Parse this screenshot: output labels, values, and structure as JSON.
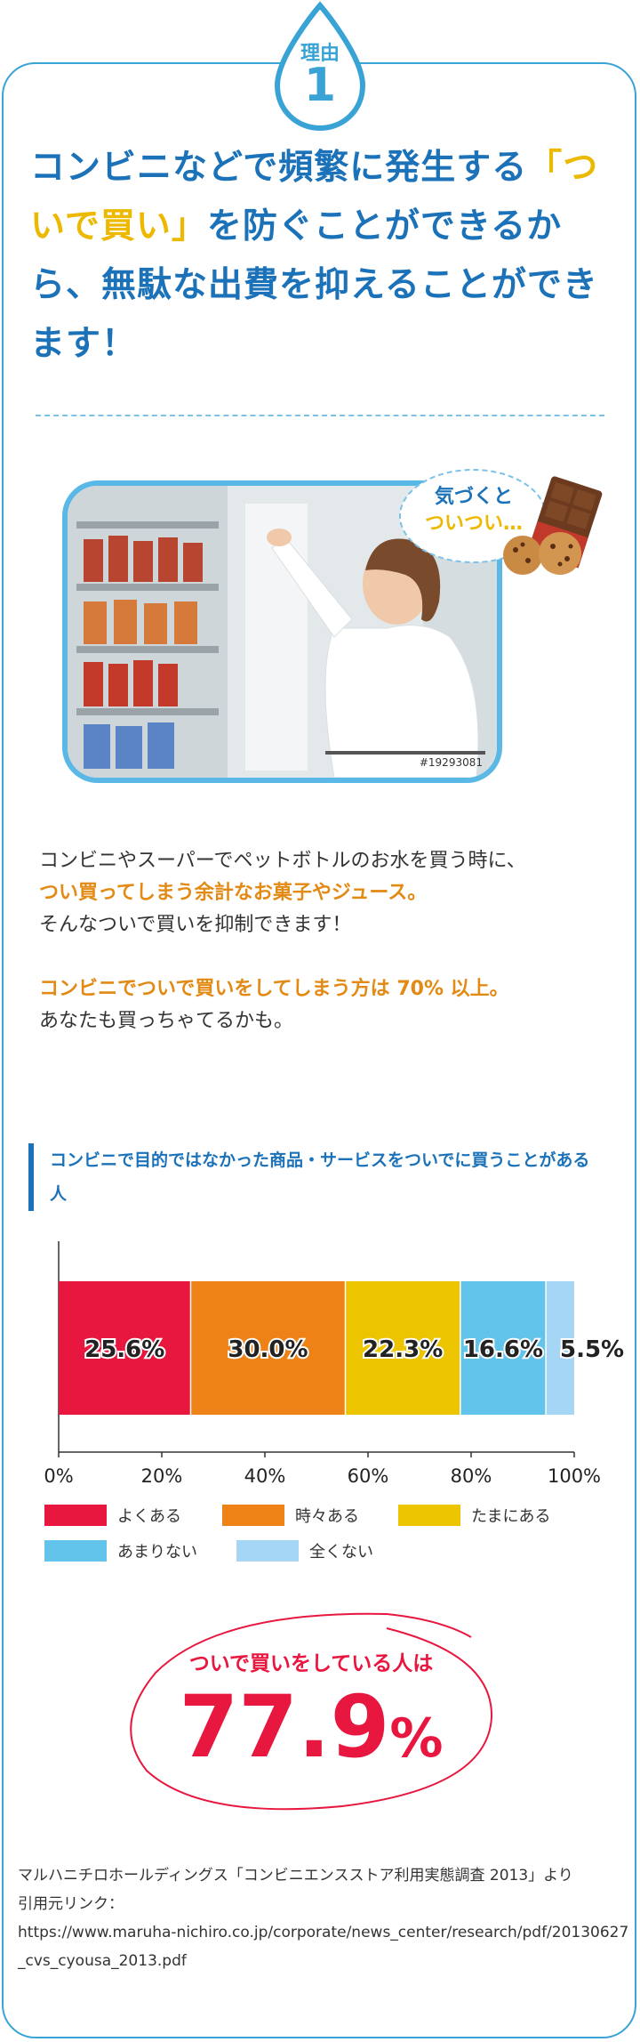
{
  "badge": {
    "label": "理由",
    "number": "1"
  },
  "headline": {
    "part1": "コンビニなどで頻繁に発生する",
    "highlight": "「ついで買い」",
    "part2": "を防ぐことができるから、無駄な出費を抑えることができます！"
  },
  "photo": {
    "stock_id": "#19293081"
  },
  "bubble": {
    "line1": "気づくと",
    "line2": "ついつい…"
  },
  "body": {
    "p1_line1": "コンビニやスーパーでペットボトルのお水を買う時に、",
    "p1_line2": "つい買ってしまう余計なお菓子やジュース。",
    "p1_line3": "そんなついで買いを抑制できます！",
    "p2_line1": "コンビニでついで買いをしてしまう方は 70% 以上。",
    "p2_line2": "あなたも買っちゃてるかも。"
  },
  "chart_data": {
    "type": "bar",
    "orientation": "horizontal-stacked",
    "title": "コンビニで目的ではなかった商品・サービスをついでに買うことがある人",
    "xlim": [
      0,
      100
    ],
    "ticks": [
      "0%",
      "20%",
      "40%",
      "60%",
      "80%",
      "100%"
    ],
    "series": [
      {
        "name": "よくある",
        "value": 25.6,
        "label": "25.6%",
        "color": "#e8173f"
      },
      {
        "name": "時々ある",
        "value": 30.0,
        "label": "30.0%",
        "color": "#ee8216"
      },
      {
        "name": "たまにある",
        "value": 22.3,
        "label": "22.3%",
        "color": "#ecc500"
      },
      {
        "name": "あまりない",
        "value": 16.6,
        "label": "16.6%",
        "color": "#62c4ea"
      },
      {
        "name": "全くない",
        "value": 5.5,
        "label": "5.5%",
        "color": "#a5d6f5"
      }
    ],
    "legend_position": "bottom"
  },
  "stat": {
    "label": "ついで買いをしている人は",
    "value": "77.9",
    "unit": "%"
  },
  "source": {
    "line1": "マルハニチロホールディングス「コンビニエンスストア利用実態調査 2013」より",
    "line2": "引用元リンク：",
    "url": "https://www.maruha-nichiro.co.jp/corporate/news_center/research/pdf/20130627_cvs_cyousa_2013.pdf"
  },
  "colors": {
    "accent_blue": "#1b72b8",
    "border_blue": "#3aa3d6",
    "yellow": "#ecb800",
    "orange": "#e28a14",
    "red": "#e8173f"
  },
  "icons": {
    "badge": "water-drop-icon",
    "chocolate": "chocolate-icon",
    "cookies": "cookie-icon"
  }
}
